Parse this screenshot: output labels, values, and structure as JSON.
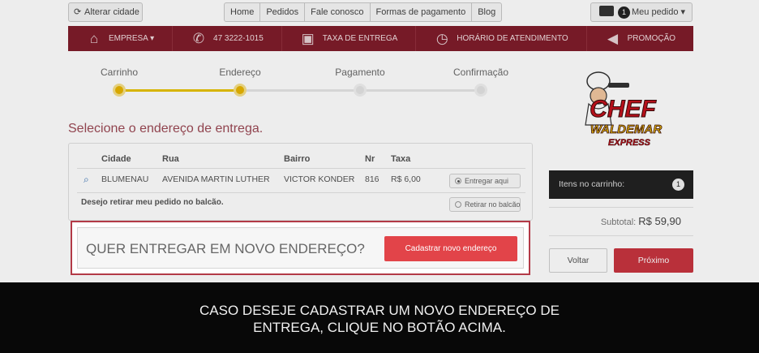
{
  "topbar": {
    "change_city": "Alterar cidade",
    "nav": [
      "Home",
      "Pedidos",
      "Fale conosco",
      "Formas de pagamento",
      "Blog"
    ],
    "order_count": "1",
    "order_label": "Meu pedido ▾"
  },
  "rednav": [
    {
      "label": "EMPRESA ▾",
      "icon": "house-icon"
    },
    {
      "label": "47 3222-1015",
      "icon": "phone-icon"
    },
    {
      "label": "TAXA DE ENTREGA",
      "icon": "delivery-box-icon"
    },
    {
      "label": "HORÁRIO DE ATENDIMENTO",
      "icon": "clock-icon"
    },
    {
      "label": "PROMOÇÃO",
      "icon": "megaphone-icon"
    }
  ],
  "steps": [
    {
      "label": "Carrinho",
      "active": true
    },
    {
      "label": "Endereço",
      "active": true
    },
    {
      "label": "Pagamento",
      "active": false
    },
    {
      "label": "Confirmação",
      "active": false
    }
  ],
  "page_title": "Selecione o endereço de entrega.",
  "address_table": {
    "headers": {
      "city": "Cidade",
      "street": "Rua",
      "district": "Bairro",
      "number": "Nr",
      "fee": "Taxa"
    },
    "row": {
      "city": "BLUMENAU",
      "street": "AVENIDA MARTIN LUTHER",
      "district": "VICTOR KONDER",
      "number": "816",
      "fee": "R$ 6,00",
      "action": "Entregar aqui"
    },
    "pickup_text": "Desejo retirar meu pedido no balcão.",
    "pickup_action": "Retirar no balcão"
  },
  "new_address": {
    "question": "QUER ENTREGAR EM NOVO ENDEREÇO?",
    "button": "Cadastrar novo endereço"
  },
  "logo": {
    "line1": "CHEF",
    "line2": "WALDEMAR",
    "line3": "EXPRESS"
  },
  "cart": {
    "items_label": "Itens no carrinho:",
    "items_count": "1",
    "subtotal_label": "Subtotal:",
    "subtotal_value": "R$ 59,90",
    "back": "Voltar",
    "next": "Próximo"
  },
  "caption": {
    "line1": "CASO DESEJE CADASTRAR UM NOVO ENDEREÇO DE",
    "line2": "ENTREGA, CLIQUE NO BOTÃO ACIMA."
  }
}
